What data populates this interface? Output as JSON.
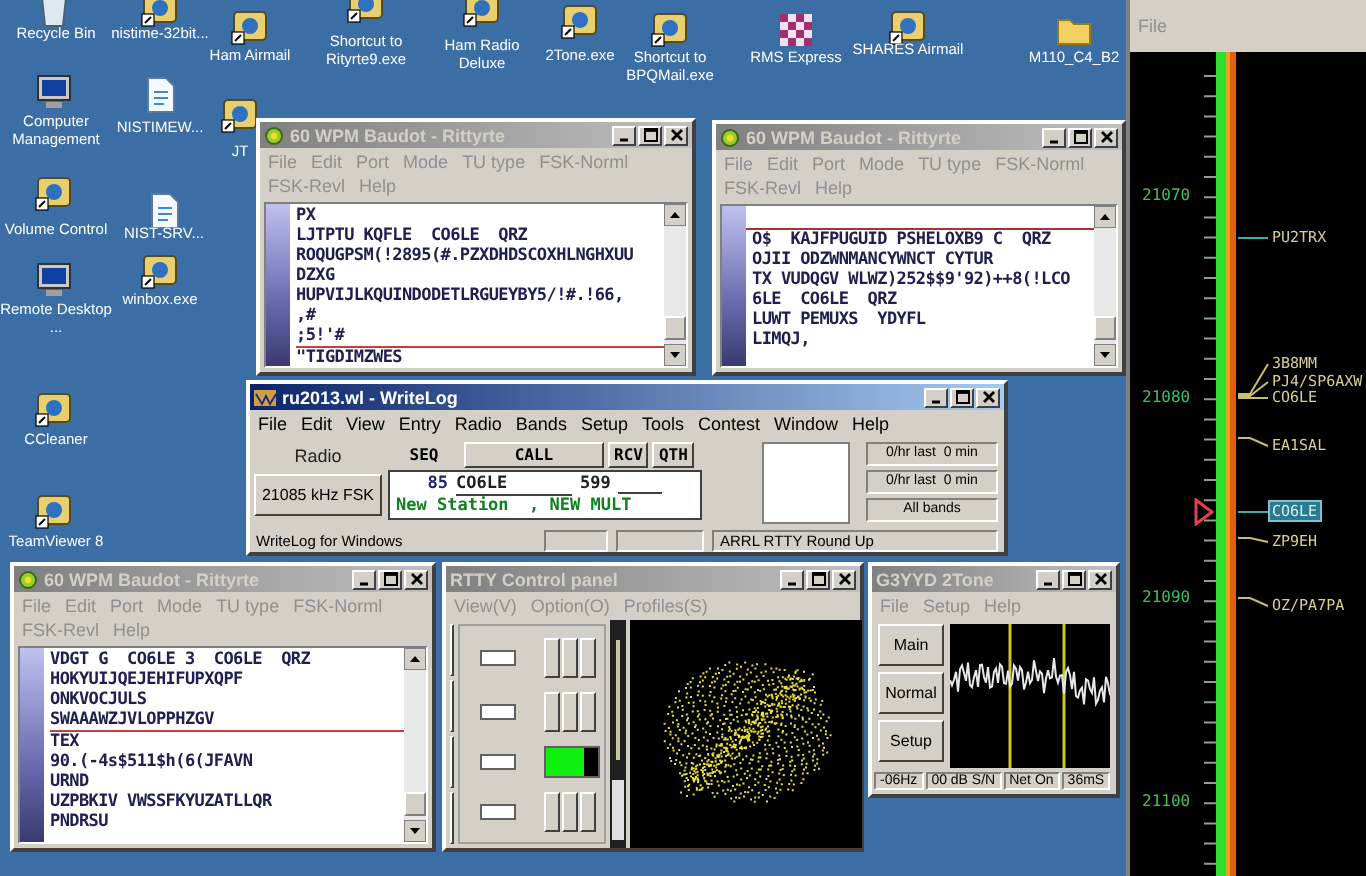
{
  "desktop_icons": [
    {
      "label": "Recycle Bin",
      "kind": "bin"
    },
    {
      "label": "nistime-32bit...",
      "kind": "app"
    },
    {
      "label": "Ham Airmail",
      "kind": "app"
    },
    {
      "label": "Shortcut to Rityrte9.exe",
      "kind": "app"
    },
    {
      "label": "Ham Radio Deluxe",
      "kind": "app"
    },
    {
      "label": "2Tone.exe",
      "kind": "app"
    },
    {
      "label": "Shortcut to BPQMail.exe",
      "kind": "app"
    },
    {
      "label": "RMS Express",
      "kind": "grid"
    },
    {
      "label": "SHARES Airmail",
      "kind": "app"
    },
    {
      "label": "M110_C4_B2",
      "kind": "folder"
    },
    {
      "label": "Computer Management",
      "kind": "monitor"
    },
    {
      "label": "NISTIMEW...",
      "kind": "doc"
    },
    {
      "label": "Volume Control",
      "kind": "app"
    },
    {
      "label": "NIST-SRV...",
      "kind": "doc"
    },
    {
      "label": "Remote Desktop ...",
      "kind": "monitor"
    },
    {
      "label": "winbox.exe",
      "kind": "app"
    },
    {
      "label": "CCleaner",
      "kind": "app"
    },
    {
      "label": "TeamViewer 8",
      "kind": "app"
    },
    {
      "label": "JT",
      "kind": "app"
    }
  ],
  "windows": [
    {
      "kind": "terminal",
      "title": "60 WPM Baudot - Rittyrte",
      "active": false,
      "menu": [
        "File",
        "Edit",
        "Port",
        "Mode",
        "TU type",
        "FSK-Norml",
        "FSK-Revl",
        "Help"
      ],
      "top_rule": false,
      "lines": [
        {
          "text": "PX",
          "rule_below": false
        },
        {
          "text": "LJTPTU KQFLE  CO6LE  QRZ",
          "rule_below": false
        },
        {
          "text": "ROQUGPSM(!2895(#.PZXDHDSCOXHLNGHXUU",
          "rule_below": false
        },
        {
          "text": "DZXG",
          "rule_below": false
        },
        {
          "text": "HUPVIJLKQUINDODETLRGUEYBY5/!#.!66,",
          "rule_below": false
        },
        {
          "text": ",#",
          "rule_below": false
        },
        {
          "text": ";5!'#",
          "rule_below": true
        },
        {
          "text": "\"TIGDIMZWES",
          "rule_below": false
        }
      ]
    },
    {
      "kind": "terminal",
      "title": "60 WPM Baudot - Rittyrte",
      "active": false,
      "menu": [
        "File",
        "Edit",
        "Port",
        "Mode",
        "TU type",
        "FSK-Norml",
        "FSK-Revl",
        "Help"
      ],
      "top_rule": true,
      "lines": [
        {
          "text": "O$  KAJFPUGUID PSHELOXB9 C  QRZ",
          "rule_below": false
        },
        {
          "text": "OJII ODZWNMANCYWNCT CYTUR",
          "rule_below": false
        },
        {
          "text": "TX VUDQGV WLWZ)252$$9'92)++8(!LCO",
          "rule_below": false
        },
        {
          "text": "6LE  CO6LE  QRZ",
          "rule_below": false
        },
        {
          "text": "LUWT PEMUXS  YDYFL",
          "rule_below": false
        },
        {
          "text": "LIMQJ,",
          "rule_below": false
        }
      ]
    },
    {
      "kind": "logger",
      "title": "ru2013.wl - WriteLog",
      "active": true,
      "menu": [
        "File",
        "Edit",
        "View",
        "Entry",
        "Radio",
        "Bands",
        "Setup",
        "Tools",
        "Contest",
        "Window",
        "Help"
      ],
      "radio_label": "Radio",
      "seq_label": "SEQ",
      "buttons": [
        "CALL",
        "RCV",
        "QTH"
      ],
      "frequency_button": "21085 kHz FSK",
      "entry": {
        "serial": "85",
        "call": "CO6LE",
        "rst": "599",
        "message": "New Station  , NEW MULT"
      },
      "rates": [
        "0/hr last  0 min",
        "0/hr last  0 min",
        "All bands"
      ],
      "status": [
        "WriteLog for Windows",
        "ARRL RTTY Round Up"
      ]
    },
    {
      "kind": "terminal",
      "title": "60 WPM Baudot - Rittyrte",
      "active": false,
      "menu": [
        "File",
        "Edit",
        "Port",
        "Mode",
        "TU type",
        "FSK-Norml",
        "FSK-Revl",
        "Help"
      ],
      "top_rule": false,
      "lines": [
        {
          "text": "VDGT G  CO6LE 3  CO6LE  QRZ",
          "rule_below": false
        },
        {
          "text": "HOKYUIJQEJEHIFUPXQPF",
          "rule_below": false
        },
        {
          "text": "ONKVOCJULS",
          "rule_below": false
        },
        {
          "text": "SWAAAWZJVLOPPHZGV",
          "rule_below": true
        },
        {
          "text": "TEX",
          "rule_below": false
        },
        {
          "text": "90.(-4s$511$h(6(JFAVN",
          "rule_below": false
        },
        {
          "text": "URND",
          "rule_below": false
        },
        {
          "text": "UZPBKIV VWSSFKYUZATLLQR",
          "rule_below": false
        },
        {
          "text": "PNDRSU",
          "rule_below": false
        }
      ]
    },
    {
      "kind": "control_panel",
      "title": "RTTY Control panel",
      "active": false,
      "menu": [
        "View(V)",
        "Option(O)",
        "Profiles(S)"
      ],
      "signal": {
        "level": 0.72
      }
    },
    {
      "kind": "scope",
      "title": "G3YYD 2Tone",
      "active": false,
      "menu": [
        "File",
        "Setup",
        "Help"
      ],
      "buttons": [
        "Main",
        "Normal",
        "Setup"
      ],
      "status": [
        "-06Hz",
        "00 dB S/N",
        "Net On",
        "36mS"
      ]
    },
    {
      "kind": "bandmap",
      "menu": [
        "File"
      ],
      "ticks": [
        "21070",
        "21080",
        "21090",
        "21100"
      ],
      "spots": [
        {
          "call": "PU2TRX",
          "selected": false
        },
        {
          "call": "3B8MM",
          "selected": false
        },
        {
          "call": "PJ4/SP6AXW",
          "selected": false
        },
        {
          "call": "CO6LE",
          "selected": false
        },
        {
          "call": "EA1SAL",
          "selected": false
        },
        {
          "call": "CO6LE",
          "selected": true
        },
        {
          "call": "ZP9EH",
          "selected": false
        },
        {
          "call": "OZ/PA7PA",
          "selected": false
        }
      ]
    }
  ]
}
